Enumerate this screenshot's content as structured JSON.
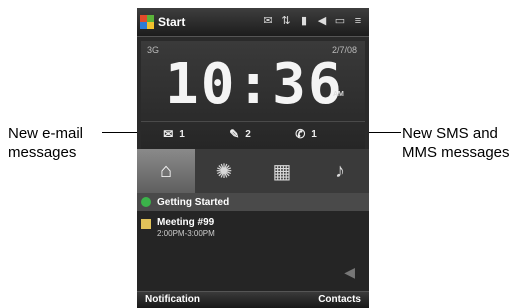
{
  "callouts": {
    "left": "New e-mail\nmessages",
    "right": "New SMS and\nMMS messages"
  },
  "topbar": {
    "start_label": "Start",
    "status_icons": [
      "message-icon",
      "connectivity-icon",
      "signal-icon",
      "volume-icon",
      "battery-icon",
      "menu-icon"
    ]
  },
  "clock": {
    "network": "3G",
    "date": "2/7/08",
    "time": "10:36",
    "ampm": "AM"
  },
  "notifications": [
    {
      "icon": "email-icon",
      "count": "1"
    },
    {
      "icon": "sms-icon",
      "count": "2"
    },
    {
      "icon": "missed-call-icon",
      "count": "1"
    }
  ],
  "tabs": [
    "home-icon",
    "settings-icon",
    "apps-icon",
    "music-icon"
  ],
  "list": {
    "item1": "Getting Started",
    "item2_title": "Meeting #99",
    "item2_time": "2:00PM-3:00PM"
  },
  "softkeys": {
    "left": "Notification",
    "right": "Contacts"
  },
  "colors": {
    "accent_green": "#3bb34a",
    "calendar_yellow": "#e2c35a"
  }
}
